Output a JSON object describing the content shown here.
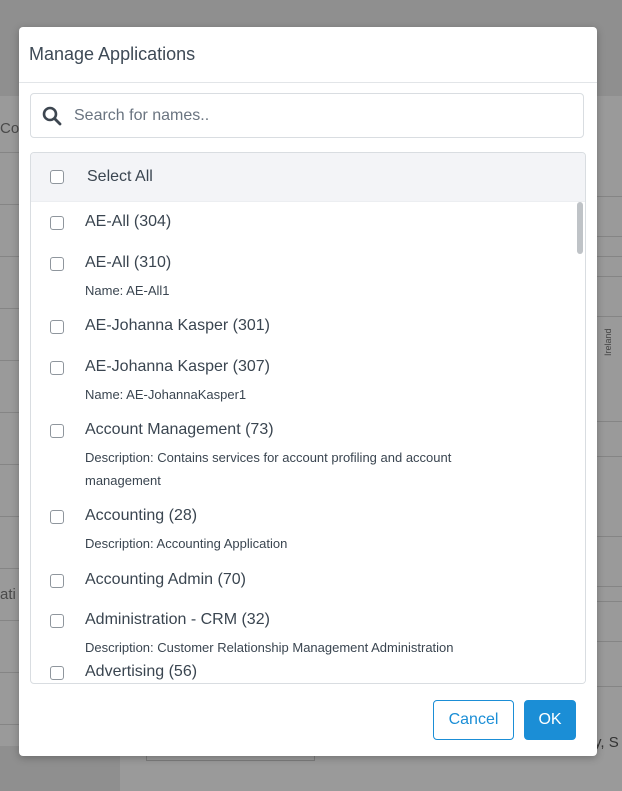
{
  "background": {
    "left_fragment_1": "Con",
    "left_fragment_2": "ati",
    "right_rotated": "Ireland",
    "bottom_fragment": "y, S"
  },
  "modal": {
    "title": "Manage Applications",
    "search": {
      "placeholder": "Search for names..",
      "value": ""
    },
    "select_all_label": "Select All",
    "items": [
      {
        "title": "AE-All (304)",
        "sub": ""
      },
      {
        "title": "AE-All (310)",
        "sub": "Name: AE-All1"
      },
      {
        "title": "AE-Johanna Kasper (301)",
        "sub": ""
      },
      {
        "title": "AE-Johanna Kasper (307)",
        "sub": "Name: AE-JohannaKasper1"
      },
      {
        "title": "Account Management (73)",
        "sub": "Description: Contains services for account profiling and account management"
      },
      {
        "title": "Accounting (28)",
        "sub": "Description: Accounting Application"
      },
      {
        "title": "Accounting Admin (70)",
        "sub": ""
      },
      {
        "title": "Administration - CRM (32)",
        "sub": "Description: Customer Relationship Management Administration"
      },
      {
        "title": "Advertising (56)",
        "sub": ""
      }
    ],
    "buttons": {
      "cancel": "Cancel",
      "ok": "OK"
    }
  },
  "colors": {
    "accent": "#1b8ed6",
    "overlay": "#8f8f8f"
  }
}
